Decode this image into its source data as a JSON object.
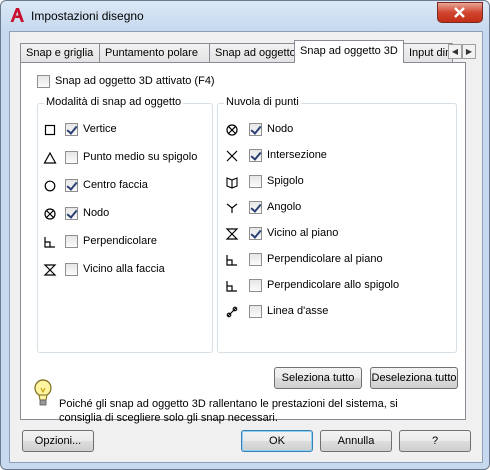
{
  "window": {
    "title": "Impostazioni disegno",
    "icon": "autocad-a-icon"
  },
  "tabs": [
    "Snap e griglia",
    "Puntamento polare",
    "Snap ad oggetto",
    "Snap ad oggetto 3D",
    "Input dinamico"
  ],
  "active_tab": "Snap ad oggetto 3D",
  "enable": {
    "label": "Snap ad oggetto 3D attivato (F4)",
    "checked": false
  },
  "left_group": {
    "title": "Modalità di snap ad oggetto",
    "items": [
      {
        "label": "Vertice",
        "checked": true,
        "symbol": "square-marker"
      },
      {
        "label": "Punto medio su spigolo",
        "checked": false,
        "symbol": "triangle-marker"
      },
      {
        "label": "Centro faccia",
        "checked": true,
        "symbol": "circle-marker"
      },
      {
        "label": "Nodo",
        "checked": true,
        "symbol": "node-marker"
      },
      {
        "label": "Perpendicolare",
        "checked": false,
        "symbol": "perpendicular-marker"
      },
      {
        "label": "Vicino alla faccia",
        "checked": false,
        "symbol": "hourglass-marker"
      }
    ]
  },
  "right_group": {
    "title": "Nuvola di punti",
    "items": [
      {
        "label": "Nodo",
        "checked": true,
        "symbol": "node-marker"
      },
      {
        "label": "Intersezione",
        "checked": true,
        "symbol": "x-marker"
      },
      {
        "label": "Spigolo",
        "checked": false,
        "symbol": "edge-marker"
      },
      {
        "label": "Angolo",
        "checked": true,
        "symbol": "y-marker"
      },
      {
        "label": "Vicino al piano",
        "checked": true,
        "symbol": "hourglass-marker"
      },
      {
        "label": "Perpendicolare al piano",
        "checked": false,
        "symbol": "perpendicular-marker"
      },
      {
        "label": "Perpendicolare allo spigolo",
        "checked": false,
        "symbol": "perpendicular-marker"
      },
      {
        "label": "Linea d'asse",
        "checked": false,
        "symbol": "centerline-marker"
      }
    ]
  },
  "select_all": "Seleziona tutto",
  "deselect_all": "Deseleziona tutto",
  "info_text": "Poiché gli snap ad oggetto 3D rallentano le prestazioni del sistema, si consiglia di scegliere solo gli snap necessari.",
  "footer": {
    "options": "Opzioni...",
    "ok": "OK",
    "cancel": "Annulla",
    "help": "?"
  }
}
